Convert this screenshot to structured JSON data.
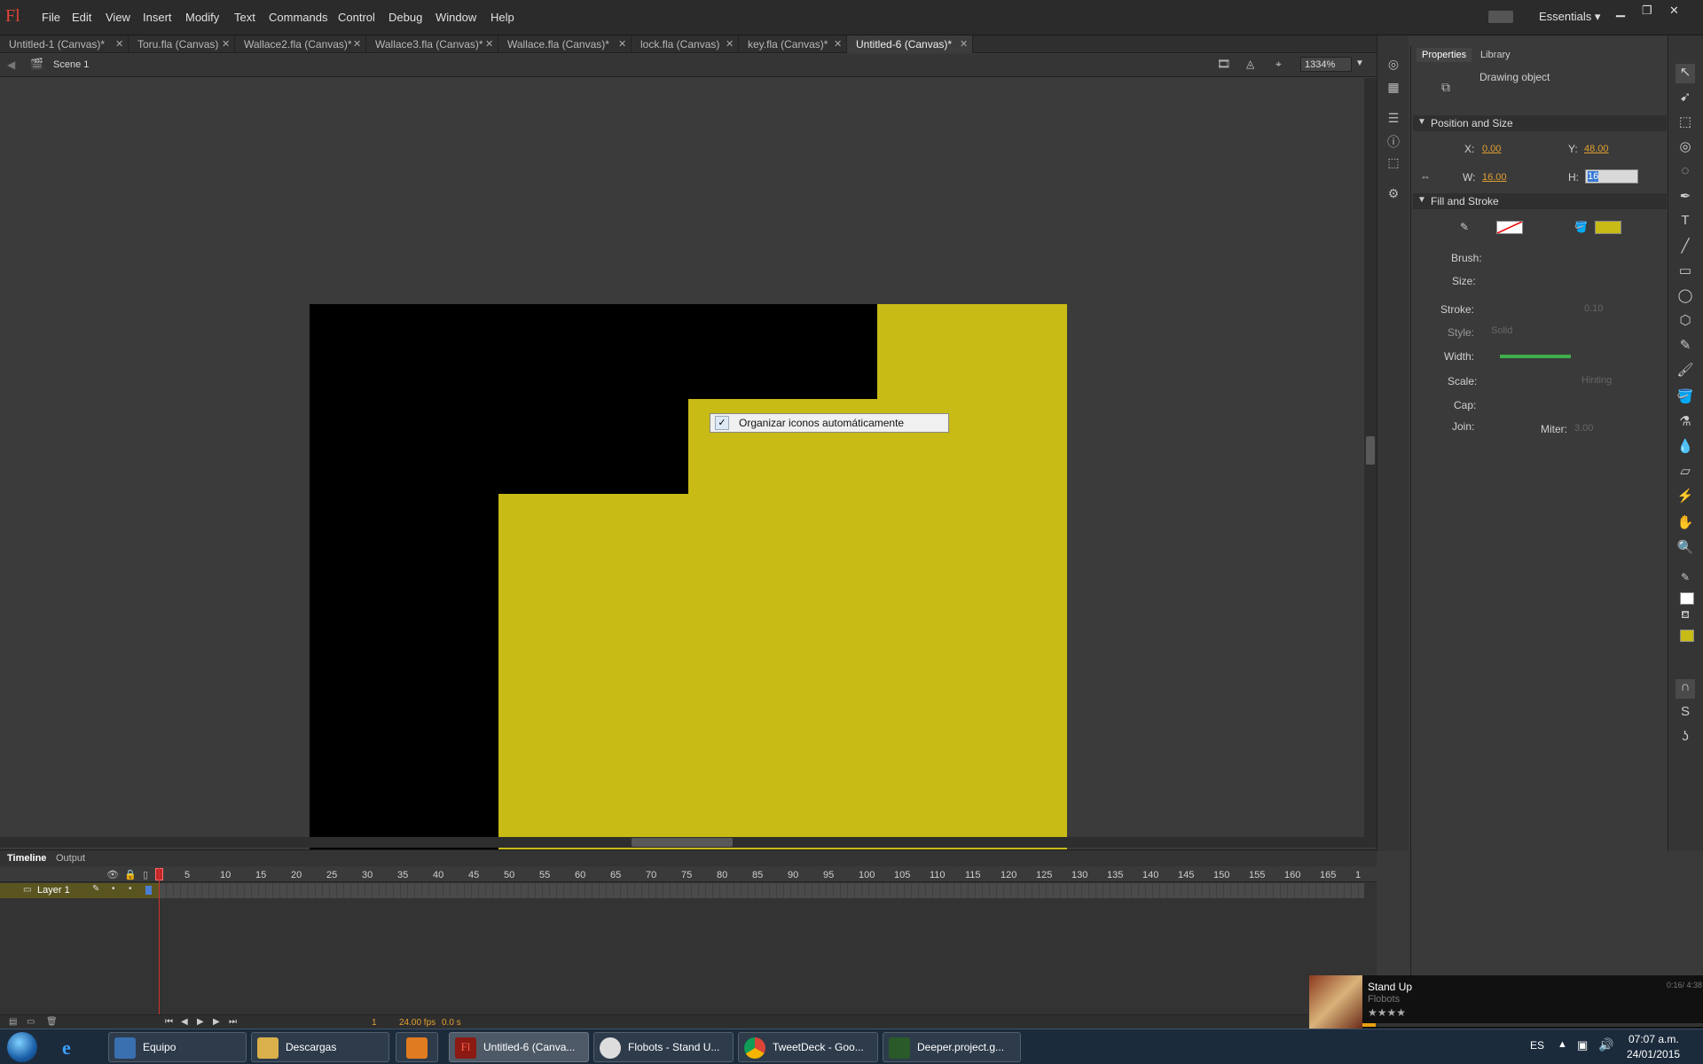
{
  "app": {
    "logo": "Fl",
    "workspace": "Essentials"
  },
  "menu": [
    "File",
    "Edit",
    "View",
    "Insert",
    "Modify",
    "Text",
    "Commands",
    "Control",
    "Debug",
    "Window",
    "Help"
  ],
  "tabs": [
    {
      "label": "Untitled-1 (Canvas)*"
    },
    {
      "label": "Toru.fla (Canvas)"
    },
    {
      "label": "Wallace2.fla (Canvas)*"
    },
    {
      "label": "Wallace3.fla (Canvas)*"
    },
    {
      "label": "Wallace.fla (Canvas)*"
    },
    {
      "label": "lock.fla (Canvas)"
    },
    {
      "label": "key.fla (Canvas)*"
    },
    {
      "label": "Untitled-6 (Canvas)*"
    }
  ],
  "editbar": {
    "scene": "Scene 1",
    "zoom": "1334%"
  },
  "context_menu": {
    "check": "✓",
    "label": "Organizar iconos automáticamente"
  },
  "timeline": {
    "tabs": [
      "Timeline",
      "Output"
    ],
    "frame_numbers": [
      "1",
      "5",
      "10",
      "15",
      "20",
      "25",
      "30",
      "35",
      "40",
      "45",
      "50",
      "55",
      "60",
      "65",
      "70",
      "75",
      "80",
      "85",
      "90",
      "95",
      "100",
      "105",
      "110",
      "115",
      "120",
      "125",
      "130",
      "135",
      "140",
      "145",
      "150",
      "155",
      "160",
      "165",
      "1"
    ],
    "layer_name": "Layer 1",
    "current_frame": "1",
    "fps": "24.00 fps",
    "elapsed": "0.0 s"
  },
  "properties": {
    "tabs": [
      "Properties",
      "Library"
    ],
    "object_type": "Drawing object",
    "sections": {
      "position": "Position and Size",
      "fill": "Fill and Stroke"
    },
    "x_label": "X:",
    "x": "0.00",
    "y_label": "Y:",
    "y": "48.00",
    "w_label": "W:",
    "w": "16.00",
    "h_label": "H:",
    "h": "16",
    "brush": "Brush:",
    "size": "Size:",
    "stroke": "Stroke:",
    "stroke_value": "0.10",
    "style": "Style:",
    "style_value": "Solid",
    "width": "Width:",
    "scale": "Scale:",
    "hinting": "Hinting",
    "cap": "Cap:",
    "join": "Join:",
    "miter": "Miter:",
    "miter_value": "3.00"
  },
  "colors": {
    "fill": "#c8bb15",
    "stage_black": "#000000"
  },
  "media": {
    "title": "Stand Up",
    "artist": "Flobots",
    "time": "0:16/ 4:38",
    "rating": "★★★★"
  },
  "taskbar": {
    "items": [
      {
        "label": "Equipo"
      },
      {
        "label": "Descargas"
      },
      {
        "label": ""
      },
      {
        "label": "Untitled-6 (Canva..."
      },
      {
        "label": "Flobots - Stand U..."
      },
      {
        "label": "TweetDeck - Goo..."
      },
      {
        "label": "Deeper.project.g..."
      }
    ],
    "language": "ES",
    "time": "07:07 a.m.",
    "date": "24/01/2015"
  }
}
